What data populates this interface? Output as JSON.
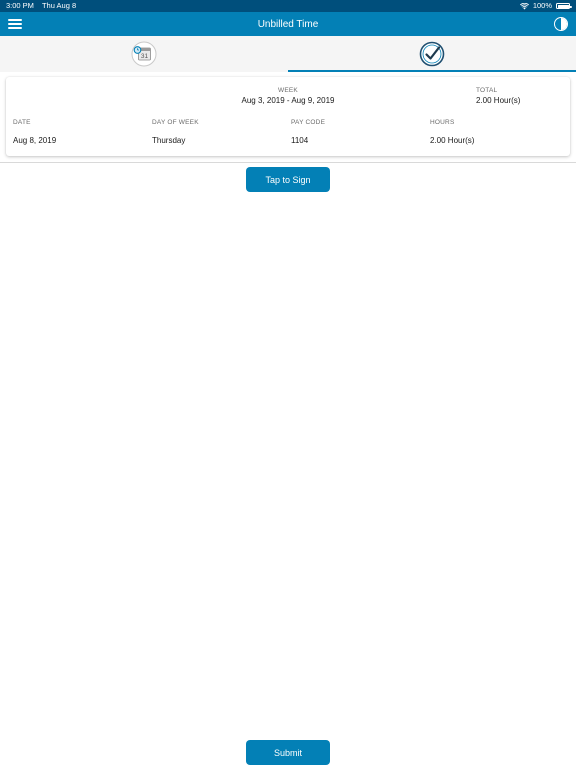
{
  "status_bar": {
    "time": "3:00 PM",
    "date": "Thu Aug 8",
    "battery": "100%",
    "battery_level": 1.0
  },
  "nav": {
    "title": "Unbilled Time"
  },
  "tabs": [
    {
      "name": "calendar-tab",
      "icon": "calendar-icon",
      "icon_text": "31",
      "active": false
    },
    {
      "name": "signature-tab",
      "icon": "check-circle-icon",
      "active": true
    }
  ],
  "summary": {
    "week_label": "WEEK",
    "week_value": "Aug 3, 2019 - Aug 9, 2019",
    "total_label": "TOTAL",
    "total_value": "2.00 Hour(s)",
    "columns": [
      "DATE",
      "DAY OF WEEK",
      "PAY CODE",
      "HOURS"
    ],
    "rows": [
      [
        "Aug 8, 2019",
        "Thursday",
        "1104",
        "2.00 Hour(s)"
      ]
    ]
  },
  "buttons": {
    "sign": "Tap to Sign",
    "submit": "Submit"
  },
  "colors": {
    "status_bar": "#004f7c",
    "nav_bar": "#0380b6",
    "accent": "#0380b6",
    "tab_strip": "#f5f5f5"
  }
}
